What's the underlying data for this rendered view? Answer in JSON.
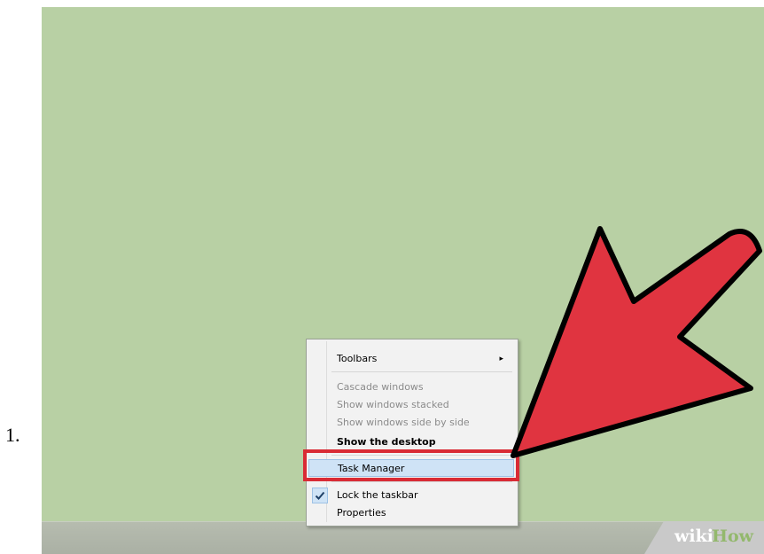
{
  "step": {
    "number": "1."
  },
  "menu": {
    "items": [
      {
        "label": "Toolbars",
        "submenu_arrow": "▸"
      },
      {
        "label": "Cascade windows"
      },
      {
        "label": "Show windows stacked"
      },
      {
        "label": "Show windows side by side"
      },
      {
        "label": "Show the desktop"
      },
      {
        "label": "Task Manager"
      },
      {
        "label": "Lock the taskbar",
        "checked": true
      },
      {
        "label": "Properties"
      }
    ]
  },
  "watermark": {
    "wiki": "wiki",
    "how": "How"
  },
  "colors": {
    "desktop": "#b8d0a4",
    "taskbar": "#b0b6aa",
    "highlight": "#d92b35",
    "arrow": "#e03440",
    "menu_hover": "#cfe3f6",
    "watermark_how": "#93b86d"
  }
}
